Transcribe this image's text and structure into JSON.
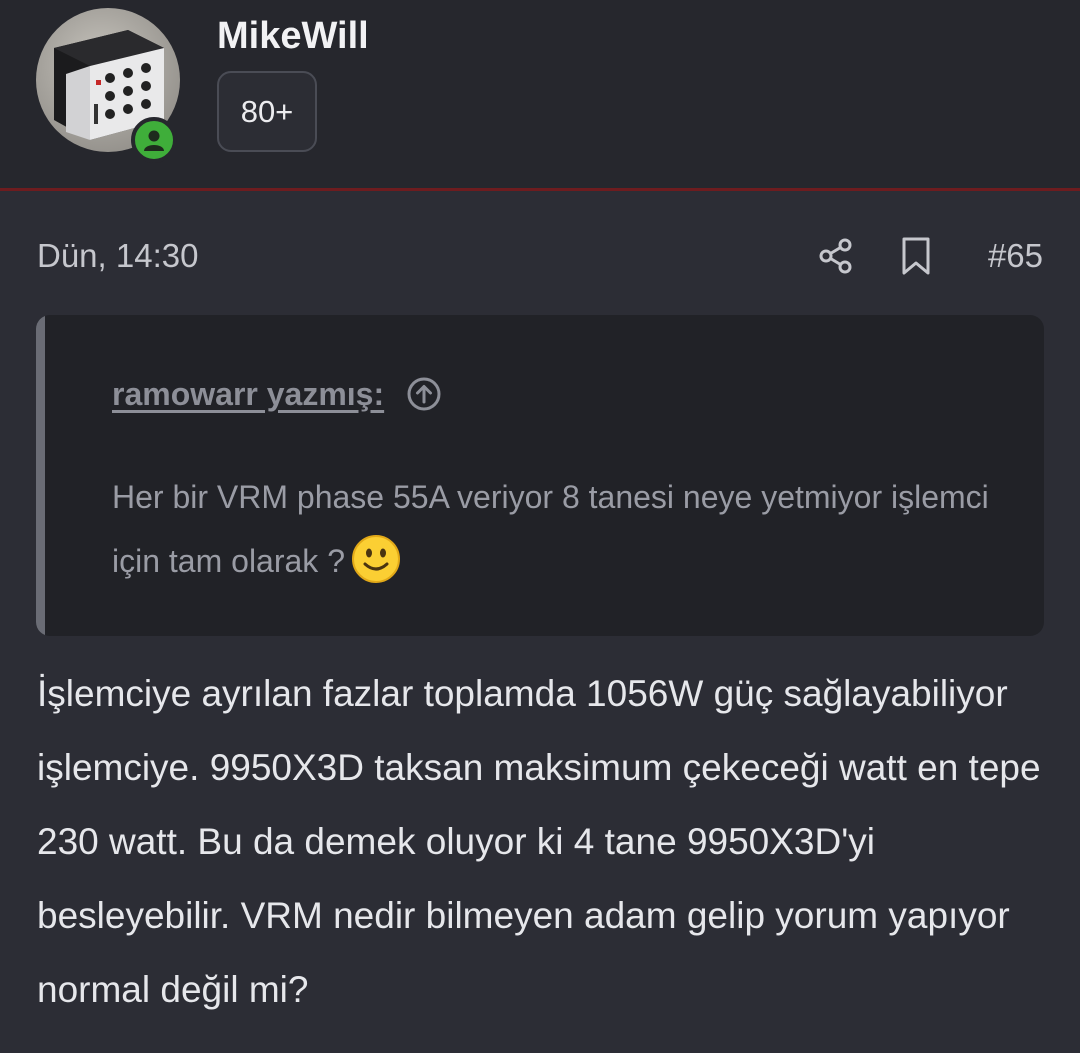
{
  "user": {
    "name": "MikeWill",
    "rank_badge": "80+",
    "online": true
  },
  "post": {
    "date": "Dün, 14:30",
    "number": "#65",
    "quote": {
      "author": "ramowarr yazmış:",
      "text": "Her bir VRM phase 55A veriyor 8 tanesi neye yetmiyor işlemci için tam olarak ?",
      "emoji": "slightly-smiling-face"
    },
    "body": "İşlemciye ayrılan fazlar toplamda 1056W güç sağlayabiliyor işlemciye. 9950X3D taksan maksimum çekeceği watt en tepe 230 watt. Bu da demek oluyor ki 4 tane 9950X3D'yi besleyebilir. VRM nedir bilmeyen adam gelip yorum yapıyor normal değil mi?"
  },
  "icons": {
    "share": "share-icon",
    "bookmark": "bookmark-icon",
    "goto_quote": "arrow-up-circle-icon",
    "online": "user-online-icon"
  },
  "colors": {
    "background": "#2c2d35",
    "header_background": "#26272d",
    "header_divider": "#6e1c1f",
    "quote_background": "#212227",
    "online_green": "#3fae3a"
  }
}
